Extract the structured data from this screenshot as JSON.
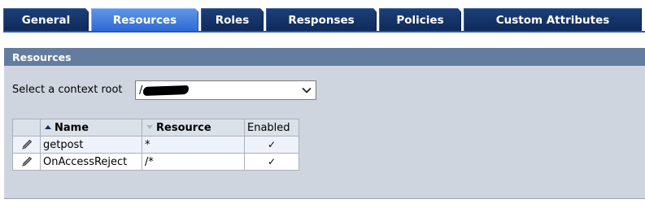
{
  "tabs": [
    {
      "label": "General",
      "active": false
    },
    {
      "label": "Resources",
      "active": true
    },
    {
      "label": "Roles",
      "active": false
    },
    {
      "label": "Responses",
      "active": false
    },
    {
      "label": "Policies",
      "active": false
    },
    {
      "label": "Custom Attributes",
      "active": false
    }
  ],
  "panel": {
    "title": "Resources",
    "context_root_label": "Select a context root",
    "context_root_value": "/"
  },
  "table": {
    "headers": {
      "name": "Name",
      "resource": "Resource",
      "enabled": "Enabled"
    },
    "rows": [
      {
        "name": "getpost",
        "resource": "*",
        "enabled": "✓"
      },
      {
        "name": "OnAccessReject",
        "resource": "/*",
        "enabled": "✓"
      }
    ]
  },
  "colors": {
    "tab": "#14336a",
    "tab_active": "#3f7ad8",
    "panel_header": "#647c9e",
    "panel_bg": "#cfd5de"
  },
  "icons": {
    "edit": "pencil-icon",
    "sort_asc": "sort-ascending-icon",
    "sort_desc": "sort-descending-icon",
    "enabled": "checkmark-icon",
    "dropdown": "chevron-down-icon"
  }
}
